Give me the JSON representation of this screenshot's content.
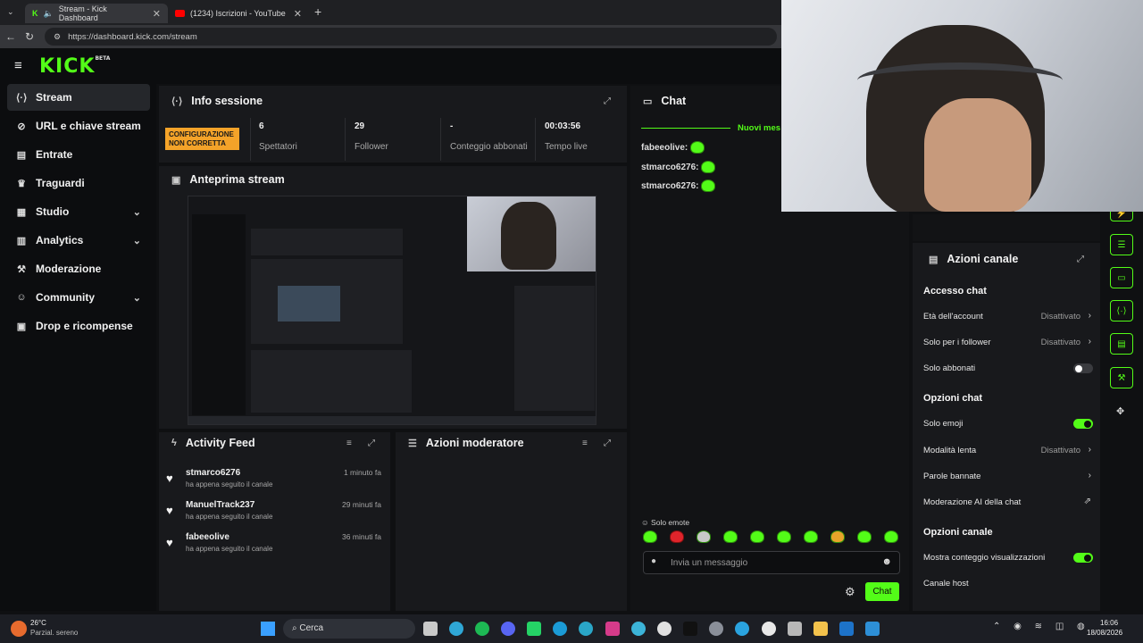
{
  "browser": {
    "tabs": [
      {
        "label": "Stream - Kick Dashboard",
        "active": true
      },
      {
        "label": "(1234) Iscrizioni - YouTube",
        "active": false
      }
    ],
    "url": "https://dashboard.kick.com/stream"
  },
  "header": {
    "logo": "KICK",
    "logo_badge": "BETA"
  },
  "sidebar": {
    "items": [
      {
        "label": "Stream",
        "icon": "stream-icon",
        "active": true
      },
      {
        "label": "URL e chiave stream",
        "icon": "key-icon"
      },
      {
        "label": "Entrate",
        "icon": "revenue-icon"
      },
      {
        "label": "Traguardi",
        "icon": "trophy-icon"
      },
      {
        "label": "Studio",
        "icon": "studio-icon",
        "expandable": true
      },
      {
        "label": "Analytics",
        "icon": "analytics-icon",
        "expandable": true
      },
      {
        "label": "Moderazione",
        "icon": "moderation-icon"
      },
      {
        "label": "Community",
        "icon": "community-icon",
        "expandable": true
      },
      {
        "label": "Drop e ricompense",
        "icon": "drops-icon"
      }
    ]
  },
  "session": {
    "title": "Info sessione",
    "badge": "CONFIGURAZIONE NON CORRETTA",
    "stats": [
      {
        "value": "6",
        "label": "Spettatori"
      },
      {
        "value": "29",
        "label": "Follower"
      },
      {
        "value": "-",
        "label": "Conteggio abbonati"
      },
      {
        "value": "00:03:56",
        "label": "Tempo live"
      }
    ]
  },
  "preview": {
    "title": "Anteprima stream"
  },
  "activity": {
    "title": "Activity Feed",
    "items": [
      {
        "name": "stmarco6276",
        "sub": "ha appena seguito il canale",
        "time": "1 minuto fa"
      },
      {
        "name": "ManuelTrack237",
        "sub": "ha appena seguito il canale",
        "time": "29 minuti fa"
      },
      {
        "name": "fabeeolive",
        "sub": "ha appena seguito il canale",
        "time": "36 minuti fa"
      }
    ]
  },
  "modactions": {
    "title": "Azioni moderatore"
  },
  "chat": {
    "title": "Chat",
    "new_messages": "Nuovi mes",
    "messages": [
      {
        "user": "fabeeolive:"
      },
      {
        "user": "stmarco6276:"
      },
      {
        "user": "stmarco6276:"
      }
    ],
    "emote_only_label": "Solo emote",
    "input_placeholder": "Invia un messaggio",
    "send_label": "Chat"
  },
  "channel_actions": {
    "title": "Azioni canale",
    "sections": {
      "access": "Accesso chat",
      "options": "Opzioni chat",
      "channel": "Opzioni canale"
    },
    "rows": {
      "age": {
        "label": "Età dell'account",
        "value": "Disattivato"
      },
      "followers": {
        "label": "Solo per i follower",
        "value": "Disattivato"
      },
      "subs": {
        "label": "Solo abbonati",
        "on": false
      },
      "emoji": {
        "label": "Solo emoji",
        "on": true
      },
      "slow": {
        "label": "Modalità lenta",
        "value": "Disattivato"
      },
      "banned": {
        "label": "Parole bannate"
      },
      "ai": {
        "label": "Moderazione AI della chat"
      },
      "viewcount": {
        "label": "Mostra conteggio visualizzazioni",
        "on": true
      },
      "host": {
        "label": "Canale host"
      }
    }
  },
  "taskbar": {
    "weather_temp": "26°C",
    "weather_desc": "Parzial. sereno",
    "search_label": "Cerca",
    "time": "16:06",
    "date": "18/08/2026"
  },
  "colors": {
    "accent": "#53fc18",
    "warning": "#f4a329",
    "panel": "#18191c",
    "bg": "#0f1012"
  }
}
